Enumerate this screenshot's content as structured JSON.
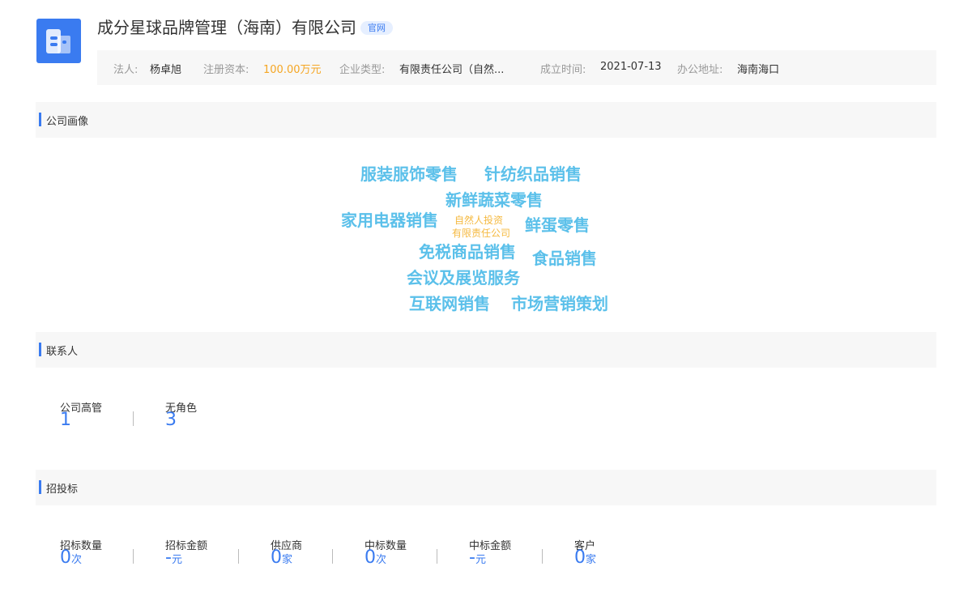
{
  "company": {
    "name": "成分星球品牌管理（海南）有限公司",
    "badge": "官网",
    "info": {
      "legal_person_label": "法人:",
      "legal_person": "杨卓旭",
      "capital_label": "注册资本:",
      "capital": "100.00万元",
      "type_label": "企业类型:",
      "type": "有限责任公司（自然...",
      "founded_label": "成立时间:",
      "founded": "2021-07-13",
      "address_label": "办公地址:",
      "address": "海南海口"
    }
  },
  "sections": {
    "portrait": "公司画像",
    "contacts": "联系人",
    "bidding": "招投标"
  },
  "word_cloud": [
    "服装服饰零售",
    "针纺织品销售",
    "新鲜蔬菜零售",
    "家用电器销售",
    "自然人投资",
    "有限责任公司",
    "鲜蛋零售",
    "免税商品销售",
    "食品销售",
    "会议及展览服务",
    "互联网销售",
    "市场营销策划"
  ],
  "contacts": [
    {
      "label": "公司高管",
      "value": "1"
    },
    {
      "label": "无角色",
      "value": "3"
    }
  ],
  "bidding": [
    {
      "label": "招标数量",
      "value": "0",
      "unit": "次"
    },
    {
      "label": "招标金额",
      "value": "-",
      "unit": "元"
    },
    {
      "label": "供应商",
      "value": "0",
      "unit": "家"
    },
    {
      "label": "中标数量",
      "value": "0",
      "unit": "次"
    },
    {
      "label": "中标金额",
      "value": "-",
      "unit": "元"
    },
    {
      "label": "客户",
      "value": "0",
      "unit": "家"
    }
  ],
  "colors": {
    "accent": "#3a7bf0",
    "word_cloud_main": "#5bc0ea",
    "word_cloud_small": "#f5b940",
    "capital_highlight": "#f5a623"
  },
  "icons": {
    "logo": "building-icon"
  }
}
